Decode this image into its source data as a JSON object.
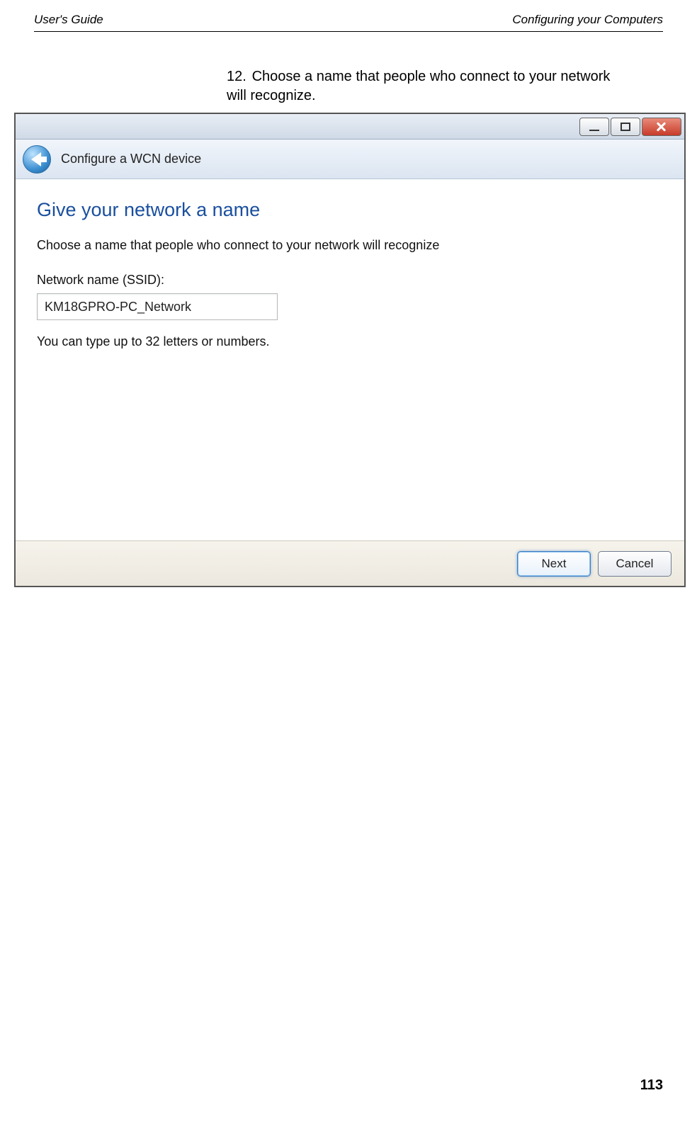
{
  "doc": {
    "header_left": "User's Guide",
    "header_right": "Configuring your Computers",
    "step_number": "12.",
    "step_text": "Choose a name that people who connect to your network will recognize.",
    "page_number": "113"
  },
  "window": {
    "breadcrumb": "Configure a WCN device",
    "title": "Give your network a name",
    "subtitle": "Choose a name that people who connect to your network will recognize",
    "ssid_label": "Network name (SSID):",
    "ssid_value": "KM18GPRO-PC_Network",
    "hint": "You can type up to 32 letters or numbers.",
    "buttons": {
      "next": "Next",
      "cancel": "Cancel"
    },
    "icons": {
      "back": "back-arrow-icon",
      "minimize": "minimize-icon",
      "maximize": "maximize-icon",
      "close": "close-icon"
    }
  }
}
